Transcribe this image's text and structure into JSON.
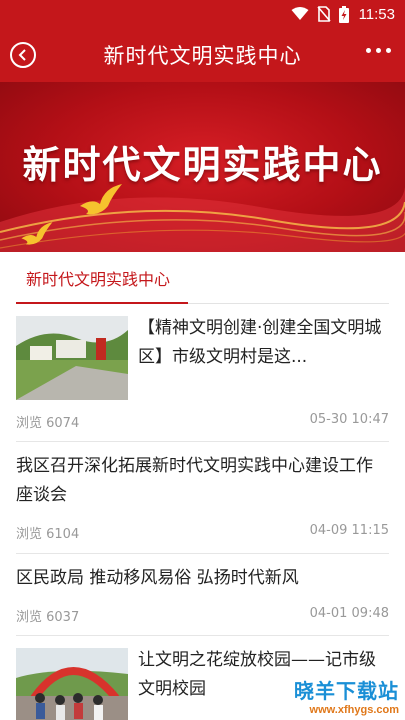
{
  "status_bar": {
    "time": "11:53"
  },
  "header": {
    "title": "新时代文明实践中心"
  },
  "banner": {
    "title": "新时代文明实践中心"
  },
  "tabs": [
    {
      "label": "新时代文明实践中心",
      "active": true
    }
  ],
  "news": [
    {
      "title": "【精神文明创建·创建全国文明城区】市级文明村是这...",
      "views": "浏览 6074",
      "date": "05-30 10:47",
      "has_image": true
    },
    {
      "title": "我区召开深化拓展新时代文明实践中心建设工作座谈会",
      "views": "浏览 6104",
      "date": "04-09 11:15",
      "has_image": false
    },
    {
      "title": "区民政局 推动移风易俗 弘扬时代新风",
      "views": "浏览 6037",
      "date": "04-01 09:48",
      "has_image": false
    },
    {
      "title": "让文明之花绽放校园——记市级文明校园",
      "has_image": true
    }
  ],
  "watermark": {
    "name": "晓羊下载站",
    "url": "www.xfhygs.com"
  },
  "colors": {
    "brand_red": "#c4171b",
    "meta_gray": "#999999"
  }
}
